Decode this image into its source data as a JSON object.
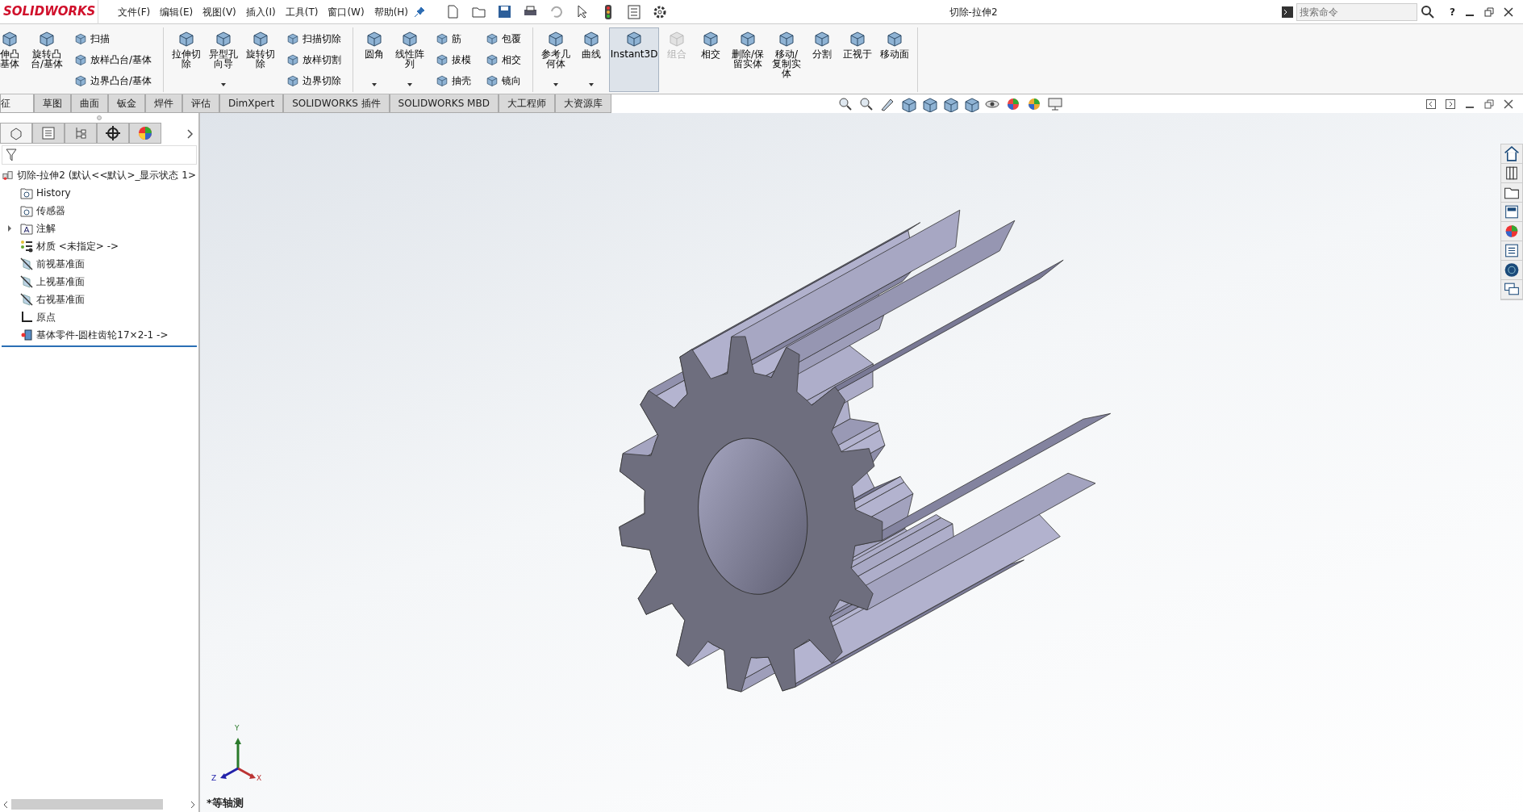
{
  "title_bar": {
    "logo": "SOLIDWORKS",
    "menu": [
      "文件(F)",
      "编辑(E)",
      "视图(V)",
      "插入(I)",
      "工具(T)",
      "窗口(W)",
      "帮助(H)"
    ],
    "title": "切除-拉伸2",
    "search": {
      "placeholder": "搜索命令"
    },
    "help": "?"
  },
  "ribbon": {
    "groups": [
      {
        "items": [
          {
            "kind": "large",
            "label": [
              "伸凸",
              "基体"
            ],
            "caret": false,
            "selected": false,
            "disabled": false
          },
          {
            "kind": "large",
            "label": [
              "旋转凸",
              "台/基体"
            ],
            "caret": false,
            "selected": false,
            "disabled": false
          },
          {
            "kind": "stack",
            "labels": [
              "扫描",
              "放样凸台/基体",
              "边界凸台/基体"
            ]
          }
        ]
      },
      {
        "items": [
          {
            "kind": "large",
            "label": [
              "拉伸切",
              "除"
            ],
            "caret": false,
            "selected": false,
            "disabled": false
          },
          {
            "kind": "large",
            "label": [
              "异型孔",
              "向导"
            ],
            "caret": true,
            "selected": false,
            "disabled": false
          },
          {
            "kind": "large",
            "label": [
              "旋转切",
              "除"
            ],
            "caret": false,
            "selected": false,
            "disabled": false
          },
          {
            "kind": "stack",
            "labels": [
              "扫描切除",
              "放样切割",
              "边界切除"
            ]
          }
        ]
      },
      {
        "items": [
          {
            "kind": "large",
            "label": [
              "圆角"
            ],
            "caret": true,
            "selected": false,
            "disabled": false
          },
          {
            "kind": "large",
            "label": [
              "线性阵",
              "列"
            ],
            "caret": true,
            "selected": false,
            "disabled": false
          },
          {
            "kind": "stack",
            "labels": [
              "筋",
              "拔模",
              "抽壳"
            ]
          },
          {
            "kind": "stack",
            "labels": [
              "包覆",
              "相交",
              "镜向"
            ]
          }
        ]
      },
      {
        "items": [
          {
            "kind": "large",
            "label": [
              "参考几",
              "何体"
            ],
            "caret": true,
            "selected": false,
            "disabled": false
          },
          {
            "kind": "large",
            "label": [
              "曲线"
            ],
            "caret": true,
            "selected": false,
            "disabled": false
          },
          {
            "kind": "large",
            "label": [
              "Instant3D"
            ],
            "caret": false,
            "selected": true,
            "disabled": false
          },
          {
            "kind": "large",
            "label": [
              "组合"
            ],
            "caret": false,
            "selected": false,
            "disabled": true
          },
          {
            "kind": "large",
            "label": [
              "相交"
            ],
            "caret": false,
            "selected": false,
            "disabled": false
          },
          {
            "kind": "large",
            "label": [
              "删除/保",
              "留实体"
            ],
            "caret": false,
            "selected": false,
            "disabled": false
          },
          {
            "kind": "large",
            "label": [
              "移动/",
              "复制实",
              "体"
            ],
            "caret": false,
            "selected": false,
            "disabled": false
          },
          {
            "kind": "large",
            "label": [
              "分割"
            ],
            "caret": false,
            "selected": false,
            "disabled": false
          },
          {
            "kind": "large",
            "label": [
              "正视于"
            ],
            "caret": false,
            "selected": false,
            "disabled": false
          },
          {
            "kind": "large",
            "label": [
              "移动面"
            ],
            "caret": false,
            "selected": false,
            "disabled": false
          }
        ]
      }
    ]
  },
  "command_tabs": [
    {
      "label": "征",
      "selected": true
    },
    {
      "label": "草图",
      "selected": false
    },
    {
      "label": "曲面",
      "selected": false
    },
    {
      "label": "钣金",
      "selected": false
    },
    {
      "label": "焊件",
      "selected": false
    },
    {
      "label": "评估",
      "selected": false
    },
    {
      "label": "DimXpert",
      "selected": false
    },
    {
      "label": "SOLIDWORKS 插件",
      "selected": false
    },
    {
      "label": "SOLIDWORKS MBD",
      "selected": false
    },
    {
      "label": "大工程师",
      "selected": false
    },
    {
      "label": "大资源库",
      "selected": false
    }
  ],
  "feature_panel": {
    "tabs": [
      {
        "selected": true
      },
      {
        "selected": false
      },
      {
        "selected": false
      },
      {
        "selected": false
      },
      {
        "selected": false
      }
    ]
  },
  "feature_tree": {
    "root": "切除-拉伸2  (默认<<默认>_显示状态 1>",
    "children": [
      {
        "label": "History",
        "collapsed": false
      },
      {
        "label": "传感器",
        "collapsed": false
      },
      {
        "label": "注解",
        "collapsed": true
      },
      {
        "label": "材质 <未指定> ->",
        "collapsed": false
      },
      {
        "label": "前视基准面",
        "collapsed": false
      },
      {
        "label": "上视基准面",
        "collapsed": false
      },
      {
        "label": "右视基准面",
        "collapsed": false
      },
      {
        "label": "原点",
        "collapsed": false
      },
      {
        "label": "基体零件-圆柱齿轮17×2-1 ->",
        "collapsed": false
      }
    ]
  },
  "viewport": {
    "triad": {
      "x": "X",
      "y": "Y",
      "z": "Z"
    },
    "view_label": "*等轴测"
  }
}
